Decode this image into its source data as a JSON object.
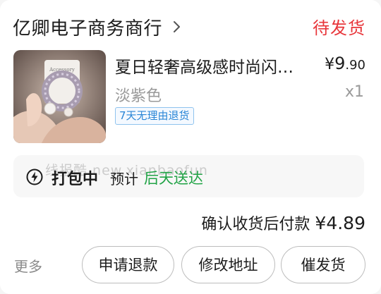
{
  "shop": {
    "name": "亿卿电子商务商行",
    "status": "待发货"
  },
  "product": {
    "title": "夏日轻奢高级感时尚闪…",
    "price_currency": "¥",
    "price_int": "9",
    "price_dec": ".90",
    "variant": "淡紫色",
    "quantity": "x1",
    "return_policy": "7天无理由退货",
    "image_icon": "product-photo"
  },
  "logistics": {
    "status": "打包中",
    "eta_prefix": "预计",
    "eta_value": "后天送达",
    "watermark": "线报酷 new.xianbaofun",
    "icon": "bolt-icon"
  },
  "payment": {
    "label": "确认收货后付款",
    "amount": "¥4.89"
  },
  "actions": {
    "more": "更多",
    "refund": "申请退款",
    "change_address": "修改地址",
    "urge": "催发货"
  },
  "colors": {
    "status_red": "#e8363b",
    "eta_green": "#21a346",
    "tag_blue": "#2a86d6"
  }
}
